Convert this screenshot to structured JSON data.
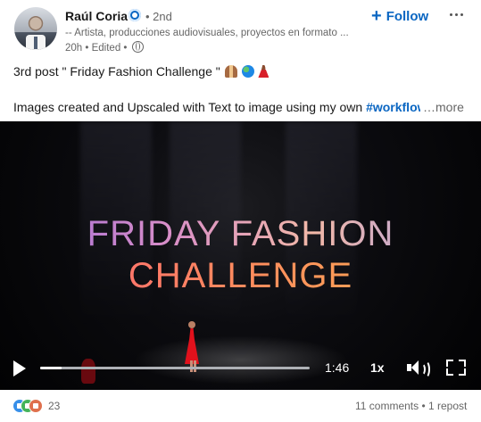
{
  "post": {
    "author": {
      "name": "Raúl Coria",
      "degree": "• 2nd",
      "headline": "-- Artista, producciones audiovisuales, proyectos en formato ...",
      "meta": "20h • Edited •"
    },
    "follow_label": "Follow",
    "text_line1": "3rd post \" Friday Fashion Challenge \"",
    "text_line2_prefix": "Images created and Upscaled with Text to image using my own ",
    "hashtag": "#workflow",
    "more_label": "…more"
  },
  "video": {
    "title_line1": "FRIDAY FASHION",
    "title_line2": "CHALLENGE",
    "time": "1:46",
    "speed": "1x",
    "progress": 0.08
  },
  "footer": {
    "reaction_count": "23",
    "stats": "11 comments • 1 repost"
  },
  "colors": {
    "accent": "#0a66c2",
    "video_bg": "#050507"
  }
}
